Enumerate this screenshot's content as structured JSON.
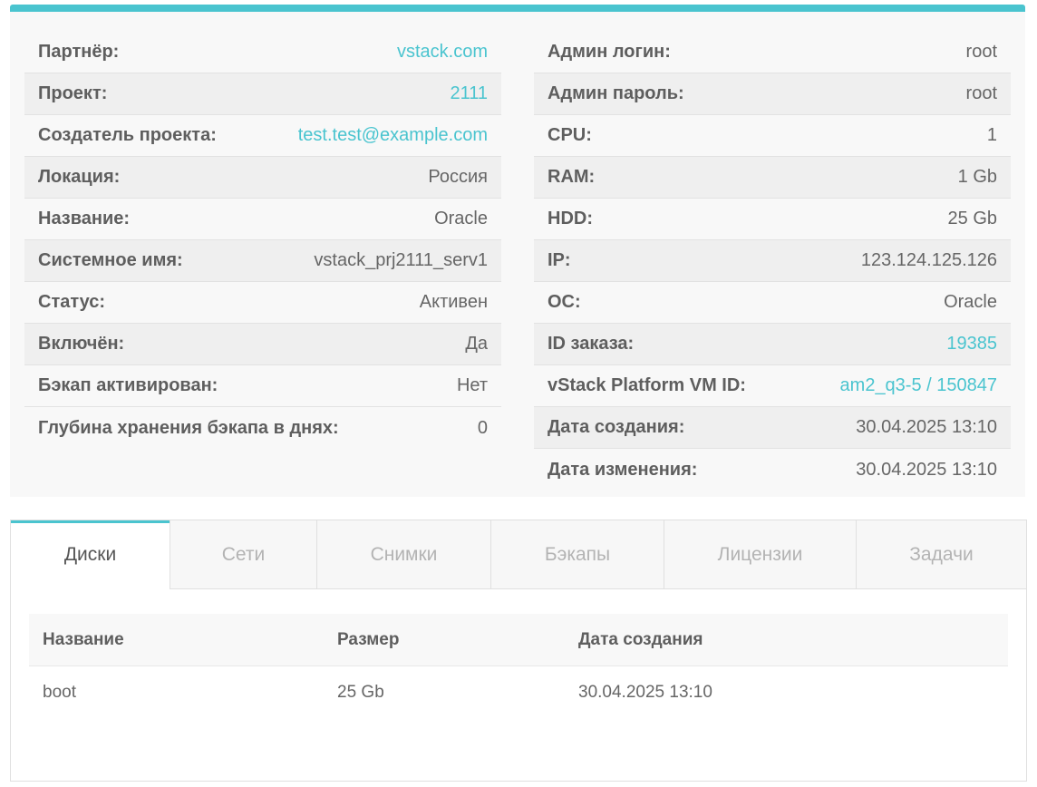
{
  "server_info": {
    "left": [
      {
        "label": "Партнёр:",
        "value": "vstack.com",
        "link": true
      },
      {
        "label": "Проект:",
        "value": "2111",
        "link": true
      },
      {
        "label": "Создатель проекта:",
        "value": "test.test@example.com",
        "link": true
      },
      {
        "label": "Локация:",
        "value": "Россия",
        "link": false
      },
      {
        "label": "Название:",
        "value": "Oracle",
        "link": false
      },
      {
        "label": "Системное имя:",
        "value": "vstack_prj2111_serv1",
        "link": false
      },
      {
        "label": "Статус:",
        "value": "Активен",
        "link": false
      },
      {
        "label": "Включён:",
        "value": "Да",
        "link": false
      },
      {
        "label": "Бэкап активирован:",
        "value": "Нет",
        "link": false
      },
      {
        "label": "Глубина хранения бэкапа в днях:",
        "value": "0",
        "link": false
      }
    ],
    "right": [
      {
        "label": "Админ логин:",
        "value": "root",
        "link": false
      },
      {
        "label": "Админ пароль:",
        "value": "root",
        "link": false
      },
      {
        "label": "CPU:",
        "value": "1",
        "link": false
      },
      {
        "label": "RAM:",
        "value": "1 Gb",
        "link": false
      },
      {
        "label": "HDD:",
        "value": "25 Gb",
        "link": false
      },
      {
        "label": "IP:",
        "value": "123.124.125.126",
        "link": false
      },
      {
        "label": "ОС:",
        "value": "Oracle",
        "link": false
      },
      {
        "label": "ID заказа:",
        "value": "19385",
        "link": true
      },
      {
        "label": "vStack Platform VM ID:",
        "value": "am2_q3-5 / 150847",
        "link": true
      },
      {
        "label": "Дата создания:",
        "value": "30.04.2025 13:10",
        "link": false
      },
      {
        "label": "Дата изменения:",
        "value": "30.04.2025 13:10",
        "link": false
      }
    ]
  },
  "tabs": [
    {
      "label": "Диски",
      "active": true
    },
    {
      "label": "Сети",
      "active": false
    },
    {
      "label": "Снимки",
      "active": false
    },
    {
      "label": "Бэкапы",
      "active": false
    },
    {
      "label": "Лицензии",
      "active": false
    },
    {
      "label": "Задачи",
      "active": false
    }
  ],
  "disks": {
    "columns": [
      "Название",
      "Размер",
      "Дата создания"
    ],
    "rows": [
      [
        "boot",
        "25 Gb",
        "30.04.2025 13:10"
      ]
    ]
  },
  "colors": {
    "accent": "#4ac4cf",
    "panel_bg": "#f8f8f8",
    "stripe_bg": "#efefef"
  }
}
